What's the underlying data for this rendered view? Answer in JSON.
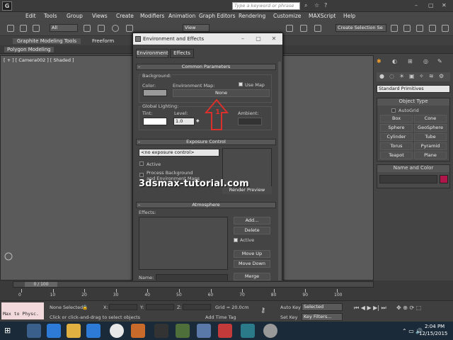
{
  "app": {
    "logo_text": "G"
  },
  "menu": [
    "Edit",
    "Tools",
    "Group",
    "Views",
    "Create",
    "Modifiers",
    "Animation",
    "Graph Editors",
    "Rendering",
    "Customize",
    "MAXScript",
    "Help"
  ],
  "search": {
    "placeholder": "Type a keyword or phrase"
  },
  "toolbar": {
    "filter_select": "All",
    "view_select": "View",
    "selection_set": "Create Selection Se"
  },
  "ribbon": {
    "tab_graphite": "Graphite Modeling Tools",
    "tab_freeform": "Freeform",
    "sub_polygon": "Polygon Modeling"
  },
  "viewport": {
    "label": "[ + ] [ Camera002 ] [ Shaded ]"
  },
  "dialog": {
    "title": "Environment and Effects",
    "tabs": [
      "Environment",
      "Effects"
    ],
    "common": {
      "header": "Common Parameters",
      "background_label": "Background:",
      "color_label": "Color:",
      "env_map_label": "Environment Map:",
      "use_map_label": "Use Map",
      "map_button": "None",
      "global_lighting_label": "Global Lighting:",
      "tint_label": "Tint:",
      "level_label": "Level:",
      "level_value": "1.0",
      "ambient_label": "Ambient:",
      "annotation_number": "1"
    },
    "exposure": {
      "header": "Exposure Control",
      "select_value": "<no exposure control>",
      "active_label": "Active",
      "process_label_1": "Process Background",
      "process_label_2": "and Environment Maps",
      "render_preview": "Render Preview"
    },
    "atmosphere": {
      "header": "Atmosphere",
      "effects_label": "Effects:",
      "add": "Add...",
      "delete": "Delete",
      "active": "Active",
      "move_up": "Move Up",
      "move_down": "Move Down",
      "name_label": "Name:",
      "merge": "Merge"
    }
  },
  "watermark": "3dsmax-tutorial.com",
  "command_panel": {
    "primitive_select": "Standard Primitives",
    "object_type_header": "Object Type",
    "autogrid": "AutoGrid",
    "buttons": [
      "Box",
      "Cone",
      "Sphere",
      "GeoSphere",
      "Cylinder",
      "Tube",
      "Torus",
      "Pyramid",
      "Teapot",
      "Plane"
    ],
    "name_color_header": "Name and Color",
    "object_color": "#b0164a"
  },
  "timeline": {
    "frame_counter": "0 / 100",
    "ticks": [
      "0",
      "10",
      "20",
      "30",
      "40",
      "50",
      "60",
      "70",
      "80",
      "90",
      "100"
    ]
  },
  "status": {
    "maxscript": "Max to Physc.",
    "none_selected": "None Selected",
    "x_label": "X:",
    "y_label": "Y:",
    "z_label": "Z:",
    "grid": "Grid = 20.0cm",
    "hint": "Click or click-and-drag to select objects",
    "add_time_tag": "Add Time Tag",
    "auto_key": "Auto Key",
    "selected": "Selected",
    "set_key": "Set Key",
    "key_filters": "Key Filters..."
  },
  "taskbar": {
    "time": "2:04 PM",
    "date": "12/15/2015"
  },
  "colors": {
    "accent_red": "#d9302b",
    "object_color": "#b0164a"
  }
}
